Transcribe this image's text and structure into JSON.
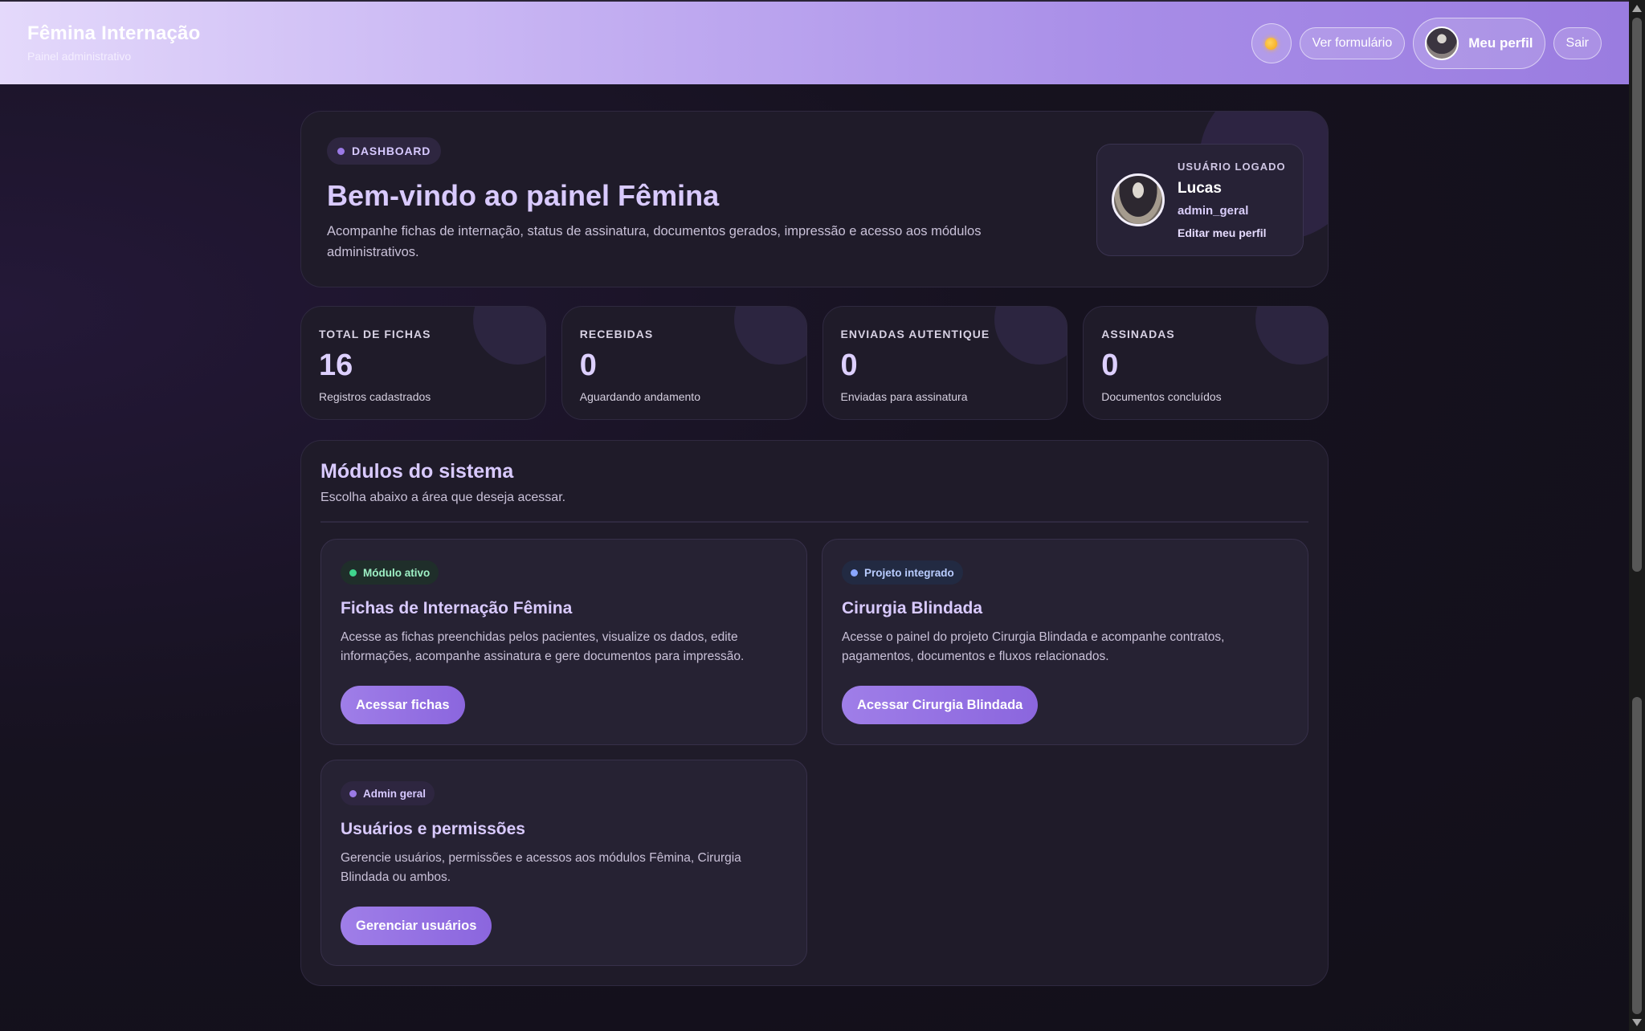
{
  "header": {
    "title": "Fêmina Internação",
    "subtitle": "Painel administrativo",
    "theme_icon": "sun-icon",
    "view_form_label": "Ver formulário",
    "profile_label": "Meu perfil",
    "logout_label": "Sair"
  },
  "hero": {
    "badge": "DASHBOARD",
    "title": "Bem-vindo ao painel Fêmina",
    "description": "Acompanhe fichas de internação, status de assinatura, documentos gerados, impressão e acesso aos módulos administrativos."
  },
  "user": {
    "label": "USUÁRIO LOGADO",
    "name": "Lucas",
    "role": "admin_geral",
    "edit_label": "Editar meu perfil"
  },
  "stats": [
    {
      "label": "TOTAL DE FICHAS",
      "value": "16",
      "note": "Registros cadastrados"
    },
    {
      "label": "RECEBIDAS",
      "value": "0",
      "note": "Aguardando andamento"
    },
    {
      "label": "ENVIADAS AUTENTIQUE",
      "value": "0",
      "note": "Enviadas para assinatura"
    },
    {
      "label": "ASSINADAS",
      "value": "0",
      "note": "Documentos concluídos"
    }
  ],
  "modules": {
    "title": "Módulos do sistema",
    "subtitle": "Escolha abaixo a área que deseja acessar.",
    "items": [
      {
        "badge": "Módulo ativo",
        "title": "Fichas de Internação Fêmina",
        "description": "Acesse as fichas preenchidas pelos pacientes, visualize os dados, edite informações, acompanhe assinatura e gere documentos para impressão.",
        "button": "Acessar fichas"
      },
      {
        "badge": "Projeto integrado",
        "title": "Cirurgia Blindada",
        "description": "Acesse o painel do projeto Cirurgia Blindada e acompanhe contratos, pagamentos, documentos e fluxos relacionados.",
        "button": "Acessar Cirurgia Blindada"
      },
      {
        "badge": "Admin geral",
        "title": "Usuários e permissões",
        "description": "Gerencie usuários, permissões e acessos aos módulos Fêmina, Cirurgia Blindada ou ambos.",
        "button": "Gerenciar usuários"
      }
    ]
  },
  "colors": {
    "accent": "#9b7ae6",
    "background": "#16121f",
    "card": "#1f1b29",
    "status_active": "#3fd58d",
    "status_integrated": "#8aa6ff"
  }
}
